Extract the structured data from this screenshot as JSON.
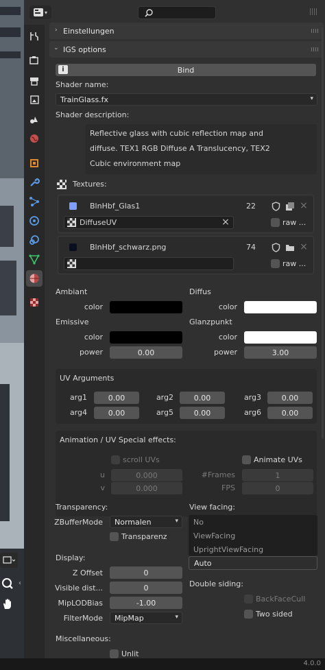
{
  "app": {
    "version": "4.0.0"
  },
  "header": {
    "search_placeholder": ""
  },
  "panels": {
    "settings": "Einstellungen",
    "igs": "IGS options"
  },
  "bind_button": "Bind",
  "shader": {
    "name_label": "Shader name:",
    "name_value": "TrainGlass.fx",
    "desc_label": "Shader description:",
    "desc_lines": [
      "Reflective glass with cubic reflection map and",
      "diffuse. TEX1 RGB Diffuse A Translucency, TEX2",
      "Cubic environment map"
    ]
  },
  "textures": {
    "label": "Textures:",
    "items": [
      {
        "name": "BlnHbf_Glas1",
        "users": "22",
        "uv": "DiffuseUV",
        "raw": "raw ...",
        "color": "#7f9fff"
      },
      {
        "name": "BlnHbf_schwarz.png",
        "users": "74",
        "uv": "",
        "raw": "raw ...",
        "color": "#0a0f1f"
      }
    ]
  },
  "material": {
    "ambiant": "Ambiant",
    "diffus": "Diffus",
    "emissive": "Emissive",
    "glanzpunkt": "Glanzpunkt",
    "color_label": "color",
    "power_label": "power",
    "ambiant_color": "#000000",
    "diffus_color": "#ffffff",
    "emissive_color": "#000000",
    "glanz_color": "#ffffff",
    "emissive_power": "0.00",
    "glanz_power": "3.00"
  },
  "uv_args": {
    "title": "UV Arguments",
    "labels": [
      "arg1",
      "arg2",
      "arg3",
      "arg4",
      "arg5",
      "arg6"
    ],
    "values": [
      "0.00",
      "0.00",
      "0.00",
      "0.00",
      "0.00",
      "0.00"
    ]
  },
  "animation": {
    "title": "Animation / UV Special effects:",
    "scroll_uvs": "scroll UVs",
    "animate_uvs": "Animate UVs",
    "u_label": "u",
    "v_label": "v",
    "u_value": "0.000",
    "v_value": "0.000",
    "frames_label": "#Frames",
    "fps_label": "FPS",
    "frames_value": "1",
    "fps_value": "0"
  },
  "transparency": {
    "label": "Transparency:",
    "zbuffer_label": "ZBufferMode",
    "zbuffer_value": "Normalen",
    "transparenz": "Transparenz"
  },
  "view_facing": {
    "label": "View facing:",
    "options": [
      "No",
      "ViewFacing",
      "UprightViewFacing",
      "Auto"
    ]
  },
  "display": {
    "label": "Display:",
    "zoffset_label": "Z Offset",
    "zoffset_value": "0",
    "visdist_label": "Visible dist...",
    "visdist_value": "0",
    "miplod_label": "MipLODBias",
    "miplod_value": "-1.00",
    "filter_label": "FilterMode",
    "filter_value": "MipMap"
  },
  "double_siding": {
    "label": "Double siding:",
    "backface": "BackFaceCull",
    "twosided": "Two sided"
  },
  "misc": {
    "label": "Miscellaneous:",
    "unlit": "Unlit"
  }
}
